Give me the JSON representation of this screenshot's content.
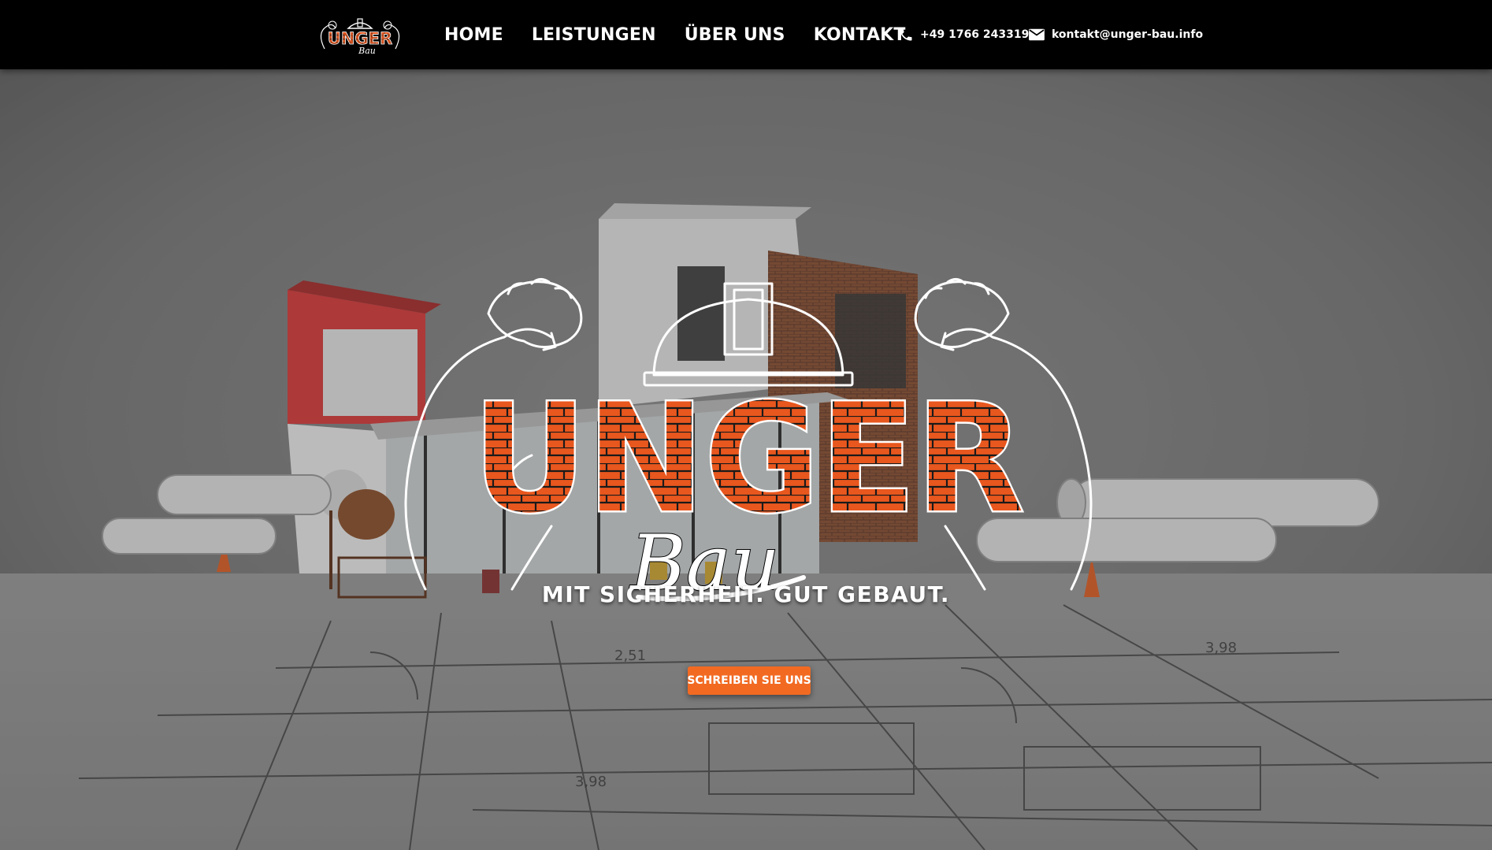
{
  "header": {
    "logo": {
      "brand": "UNGER",
      "sub": "Bau",
      "icon": "unger-bau-logo"
    },
    "nav": [
      {
        "label": "HOME"
      },
      {
        "label": "LEISTUNGEN"
      },
      {
        "label": "ÜBER UNS"
      },
      {
        "label": "KONTAKT"
      }
    ],
    "phone": {
      "icon": "phone-icon",
      "text": "+49 1766 2433192"
    },
    "email": {
      "icon": "mail-icon",
      "text": "kontakt@unger-bau.info"
    }
  },
  "hero": {
    "logo": {
      "brand": "UNGER",
      "sub": "Bau"
    },
    "tagline": "MIT SICHERHEIT. GUT GEBAUT.",
    "cta_label": "SCHREIBEN SIE UNS"
  },
  "colors": {
    "header_bg": "#000000",
    "accent": "#f26a22",
    "brick_red": "#e8571e",
    "text": "#ffffff"
  }
}
